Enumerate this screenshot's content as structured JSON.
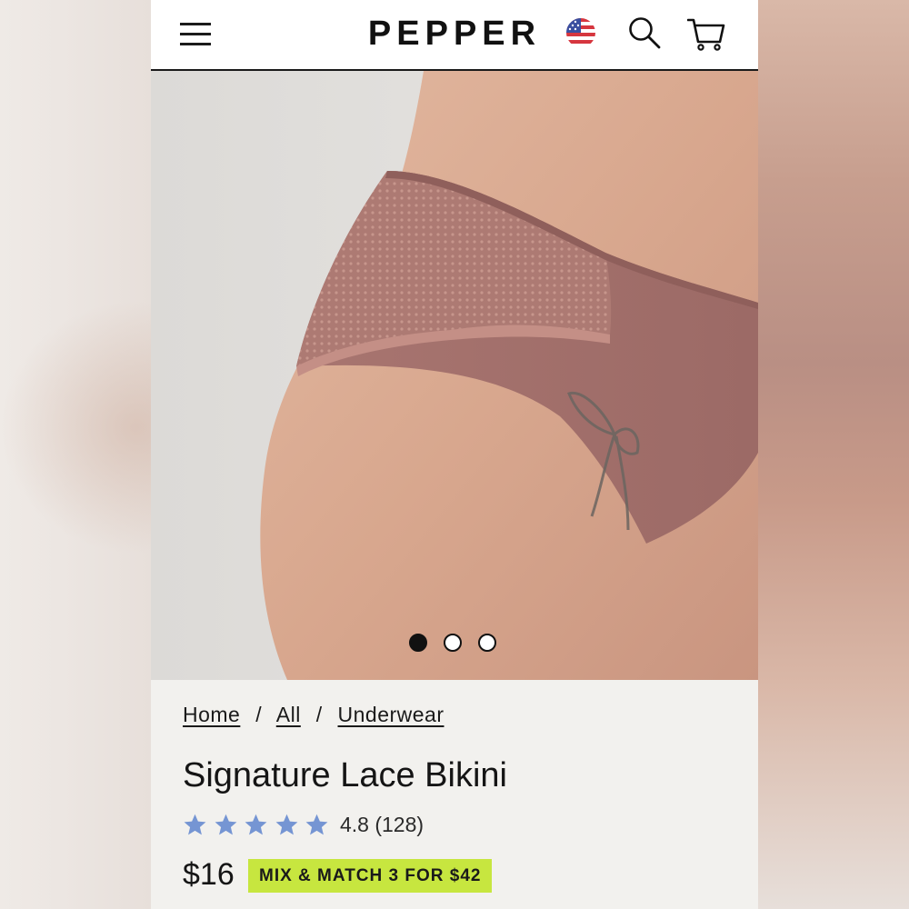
{
  "header": {
    "brand": "PEPPER",
    "menu_icon": "hamburger-menu-icon",
    "flag_icon": "us-flag-icon",
    "search_icon": "search-icon",
    "cart_icon": "cart-icon"
  },
  "gallery": {
    "image": "product-photo",
    "slide_count": 3,
    "active_slide": 1
  },
  "breadcrumb": {
    "items": [
      "Home",
      "All",
      "Underwear"
    ],
    "separator": "/"
  },
  "product": {
    "title": "Signature Lace Bikini",
    "stars": 5,
    "rating": "4.8",
    "reviews": "(128)",
    "price": "$16",
    "promo": "MIX & MATCH 3 FOR $42"
  },
  "colors": {
    "promo_bg": "#c7e63f",
    "star": "#7595d3",
    "garment": "#a8736e"
  }
}
